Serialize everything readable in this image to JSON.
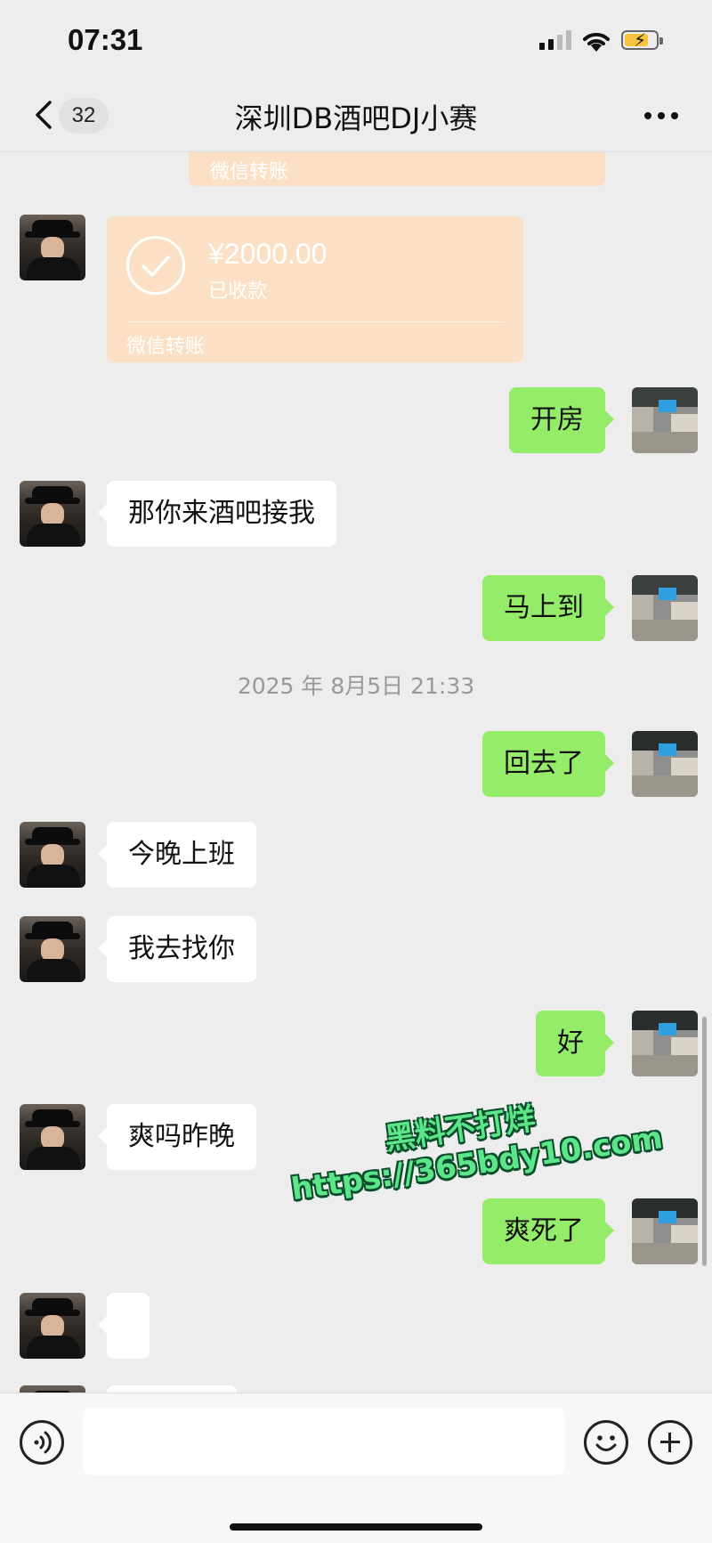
{
  "status_bar": {
    "time": "07:31"
  },
  "nav": {
    "unread_count": "32",
    "title": "深圳DB酒吧DJ小赛"
  },
  "transfer_partial": {
    "brand": "微信转账"
  },
  "transfer": {
    "amount": "¥2000.00",
    "state": "已收款",
    "brand": "微信转账",
    "bg_color": "#fbe0c6"
  },
  "messages": [
    {
      "side": "right",
      "text": "开房"
    },
    {
      "side": "left",
      "text": "那你来酒吧接我"
    },
    {
      "side": "right",
      "text": "马上到"
    },
    {
      "side": "left",
      "text": "回去了"
    },
    {
      "side": "left",
      "text": "今晚上班"
    },
    {
      "side": "right",
      "text": "我去找你"
    },
    {
      "side": "left",
      "text": "好"
    },
    {
      "side": "right",
      "text": "爽吗昨晚"
    },
    {
      "side": "left",
      "text": "爽死了"
    }
  ],
  "timestamp": "2025 年 8月5日 21:33",
  "watermark": {
    "line1": "黑料不打烊",
    "line2": "https://365bdy10.com"
  },
  "colors": {
    "bubble_right": "#95ec69",
    "bubble_left": "#ffffff",
    "chat_bg": "#ededed"
  },
  "input_bar": {
    "placeholder": ""
  }
}
